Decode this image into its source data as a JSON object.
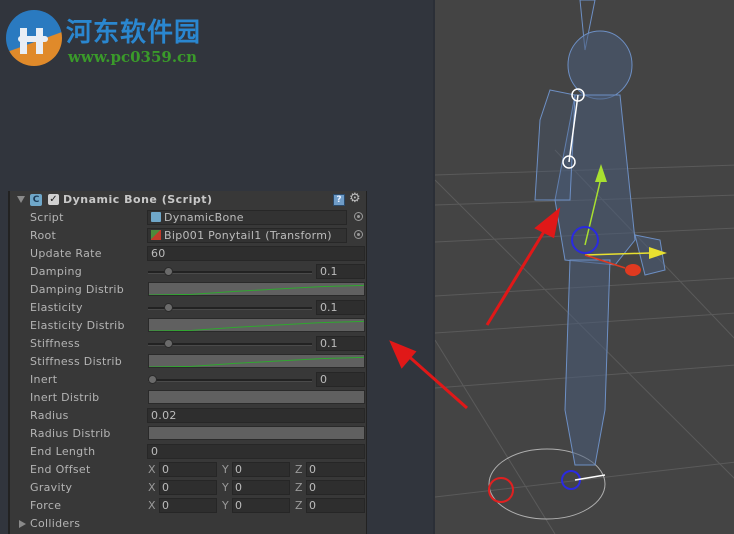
{
  "watermark": {
    "title": "河东软件园",
    "url": "www.pc0359.cn"
  },
  "component": {
    "title": "Dynamic Bone (Script)",
    "enabled": true,
    "icons": {
      "fold": "triangle-down",
      "script": "csharp-script-icon",
      "help": "help-book-icon",
      "settings": "gear-dropdown-icon"
    }
  },
  "fields": {
    "script": {
      "label": "Script",
      "value": "DynamicBone"
    },
    "root": {
      "label": "Root",
      "value": "Bip001 Ponytail1 (Transform)"
    },
    "update_rate": {
      "label": "Update Rate",
      "value": "60"
    },
    "damping": {
      "label": "Damping",
      "value": "0.1",
      "slider_fraction": 0.1
    },
    "damping_distrib": {
      "label": "Damping Distrib"
    },
    "elasticity": {
      "label": "Elasticity",
      "value": "0.1",
      "slider_fraction": 0.1
    },
    "elasticity_distrib": {
      "label": "Elasticity Distrib"
    },
    "stiffness": {
      "label": "Stiffness",
      "value": "0.1",
      "slider_fraction": 0.1
    },
    "stiffness_distrib": {
      "label": "Stiffness Distrib"
    },
    "inert": {
      "label": "Inert",
      "value": "0",
      "slider_fraction": 0.0
    },
    "inert_distrib": {
      "label": "Inert Distrib"
    },
    "radius": {
      "label": "Radius",
      "value": "0.02"
    },
    "radius_distrib": {
      "label": "Radius Distrib"
    },
    "end_length": {
      "label": "End Length",
      "value": "0"
    },
    "end_offset": {
      "label": "End Offset",
      "x": "0",
      "y": "0",
      "z": "0"
    },
    "gravity": {
      "label": "Gravity",
      "x": "0",
      "y": "0",
      "z": "0"
    },
    "force": {
      "label": "Force",
      "x": "0",
      "y": "0",
      "z": "0"
    },
    "colliders": {
      "label": "Colliders"
    }
  },
  "axis_labels": {
    "x": "X",
    "y": "Y",
    "z": "Z"
  },
  "colors": {
    "curve": "#2fa82f",
    "annotation_arrow": "#e01818",
    "gizmo_y": "#a8e030",
    "gizmo_x": "#e8e030",
    "gizmo_z": "#e03a20"
  }
}
